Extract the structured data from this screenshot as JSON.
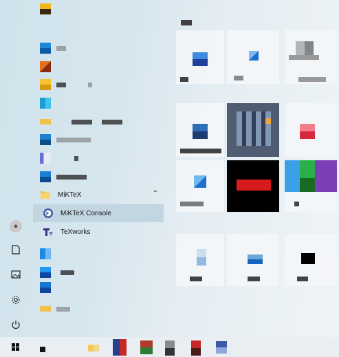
{
  "start_menu": {
    "folder": {
      "label": "MiKTeX",
      "chevron": "chevron-up-icon",
      "items": [
        {
          "label": "MiKTeX Console",
          "icon": "miktex-console-icon",
          "highlighted": true
        },
        {
          "label": "TeXworks",
          "icon": "texworks-icon",
          "highlighted": false
        }
      ]
    },
    "left_rail": [
      {
        "name": "user-avatar",
        "glyph": "☺"
      },
      {
        "name": "documents-icon",
        "glyph": "🗋"
      },
      {
        "name": "pictures-icon",
        "glyph": "▣"
      },
      {
        "name": "settings-icon",
        "glyph": "⚙"
      },
      {
        "name": "power-icon",
        "glyph": "⏻"
      }
    ],
    "colors": {
      "highlight": "#c2d6e1",
      "taskbar": "#e9eef2"
    }
  },
  "taskbar": {
    "start_icon": "windows-logo-icon"
  }
}
